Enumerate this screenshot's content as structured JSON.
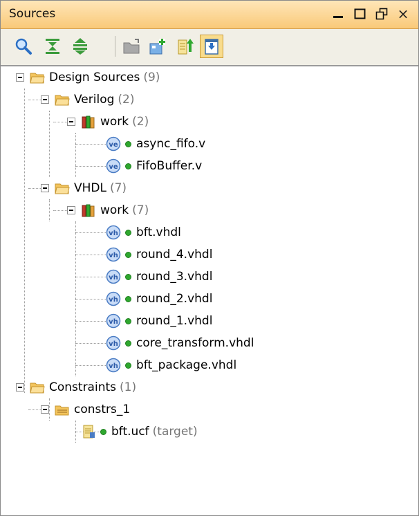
{
  "panel": {
    "title": "Sources",
    "window_controls": [
      "minimize",
      "maximize",
      "restore",
      "close"
    ],
    "close_glyph": "×"
  },
  "toolbar": {
    "buttons": [
      {
        "icon": "search-icon",
        "active": false
      },
      {
        "icon": "collapse-all-icon",
        "active": false
      },
      {
        "icon": "expand-all-icon",
        "active": false
      },
      {
        "icon": "open-folder-icon",
        "active": false
      },
      {
        "icon": "add-sources-icon",
        "active": false
      },
      {
        "icon": "hierarchy-up-icon",
        "active": false
      },
      {
        "icon": "show-file-icon",
        "active": true
      }
    ]
  },
  "tree": {
    "design_sources": {
      "label": "Design Sources",
      "count": "(9)",
      "verilog": {
        "label": "Verilog",
        "count": "(2)",
        "work": {
          "label": "work",
          "count": "(2)",
          "files": [
            "async_fifo.v",
            "FifoBuffer.v"
          ],
          "badge": "ve"
        }
      },
      "vhdl": {
        "label": "VHDL",
        "count": "(7)",
        "work": {
          "label": "work",
          "count": "(7)",
          "files": [
            "bft.vhdl",
            "round_4.vhdl",
            "round_3.vhdl",
            "round_2.vhdl",
            "round_1.vhdl",
            "core_transform.vhdl",
            "bft_package.vhdl"
          ],
          "badge": "vh"
        }
      }
    },
    "constraints": {
      "label": "Constraints",
      "count": "(1)",
      "set": {
        "label": "constrs_1",
        "files": [
          {
            "name": "bft.ucf",
            "note": "(target)"
          }
        ]
      }
    }
  },
  "colors": {
    "title_bar": "#f9c979",
    "toolbar": "#f1efe6",
    "status_dot": "#2fa82f",
    "folder": "#f3c45c",
    "count_text": "#777777"
  }
}
